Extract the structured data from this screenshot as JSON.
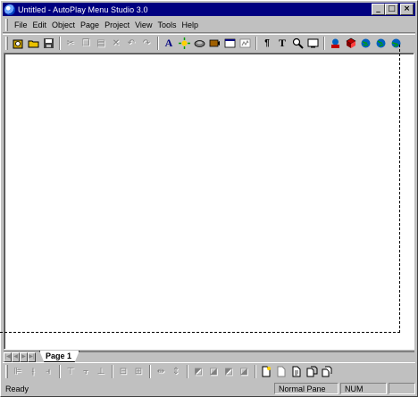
{
  "titlebar": {
    "title": "Untitled - AutoPlay Menu Studio 3.0",
    "icon": "app-globe-icon",
    "minimize": "_",
    "maximize": "□",
    "close": "×"
  },
  "menubar": {
    "items": [
      "File",
      "Edit",
      "Object",
      "Page",
      "Project",
      "View",
      "Tools",
      "Help"
    ]
  },
  "toolbar": {
    "buttons": [
      "new-project-icon",
      "open-icon",
      "save-icon",
      "cut-icon",
      "copy-icon",
      "paste-icon",
      "delete-icon",
      "undo-icon",
      "redo-icon",
      "text-object-icon",
      "image-object-icon",
      "button-object-icon",
      "video-object-icon",
      "web-object-icon",
      "flash-object-icon",
      "properties-icon",
      "text-tool-icon",
      "zoom-icon",
      "preview-icon",
      "build-icon",
      "publish-icon",
      "globe-1-icon",
      "globe-2-icon",
      "globe-3-icon"
    ]
  },
  "tabs": {
    "current": "Page 1"
  },
  "toolbar2": {
    "buttons": [
      "align-left-icon",
      "align-center-icon",
      "align-right-icon",
      "align-top-icon",
      "align-middle-icon",
      "align-bottom-icon",
      "same-width-icon",
      "same-height-icon",
      "space-horizontal-icon",
      "space-vertical-icon",
      "bring-front-icon",
      "send-back-icon",
      "bring-forward-icon",
      "send-backward-icon",
      "new-page-icon",
      "delete-page-icon",
      "page-properties-icon",
      "copy-page-icon",
      "duplicate-page-icon"
    ]
  },
  "statusbar": {
    "text": "Ready",
    "pane": "Normal Pane",
    "num": "NUM",
    "empty": ""
  },
  "colors": {
    "titlebar": "#000080",
    "face": "#c0c0c0",
    "canvas": "#ffffff"
  }
}
